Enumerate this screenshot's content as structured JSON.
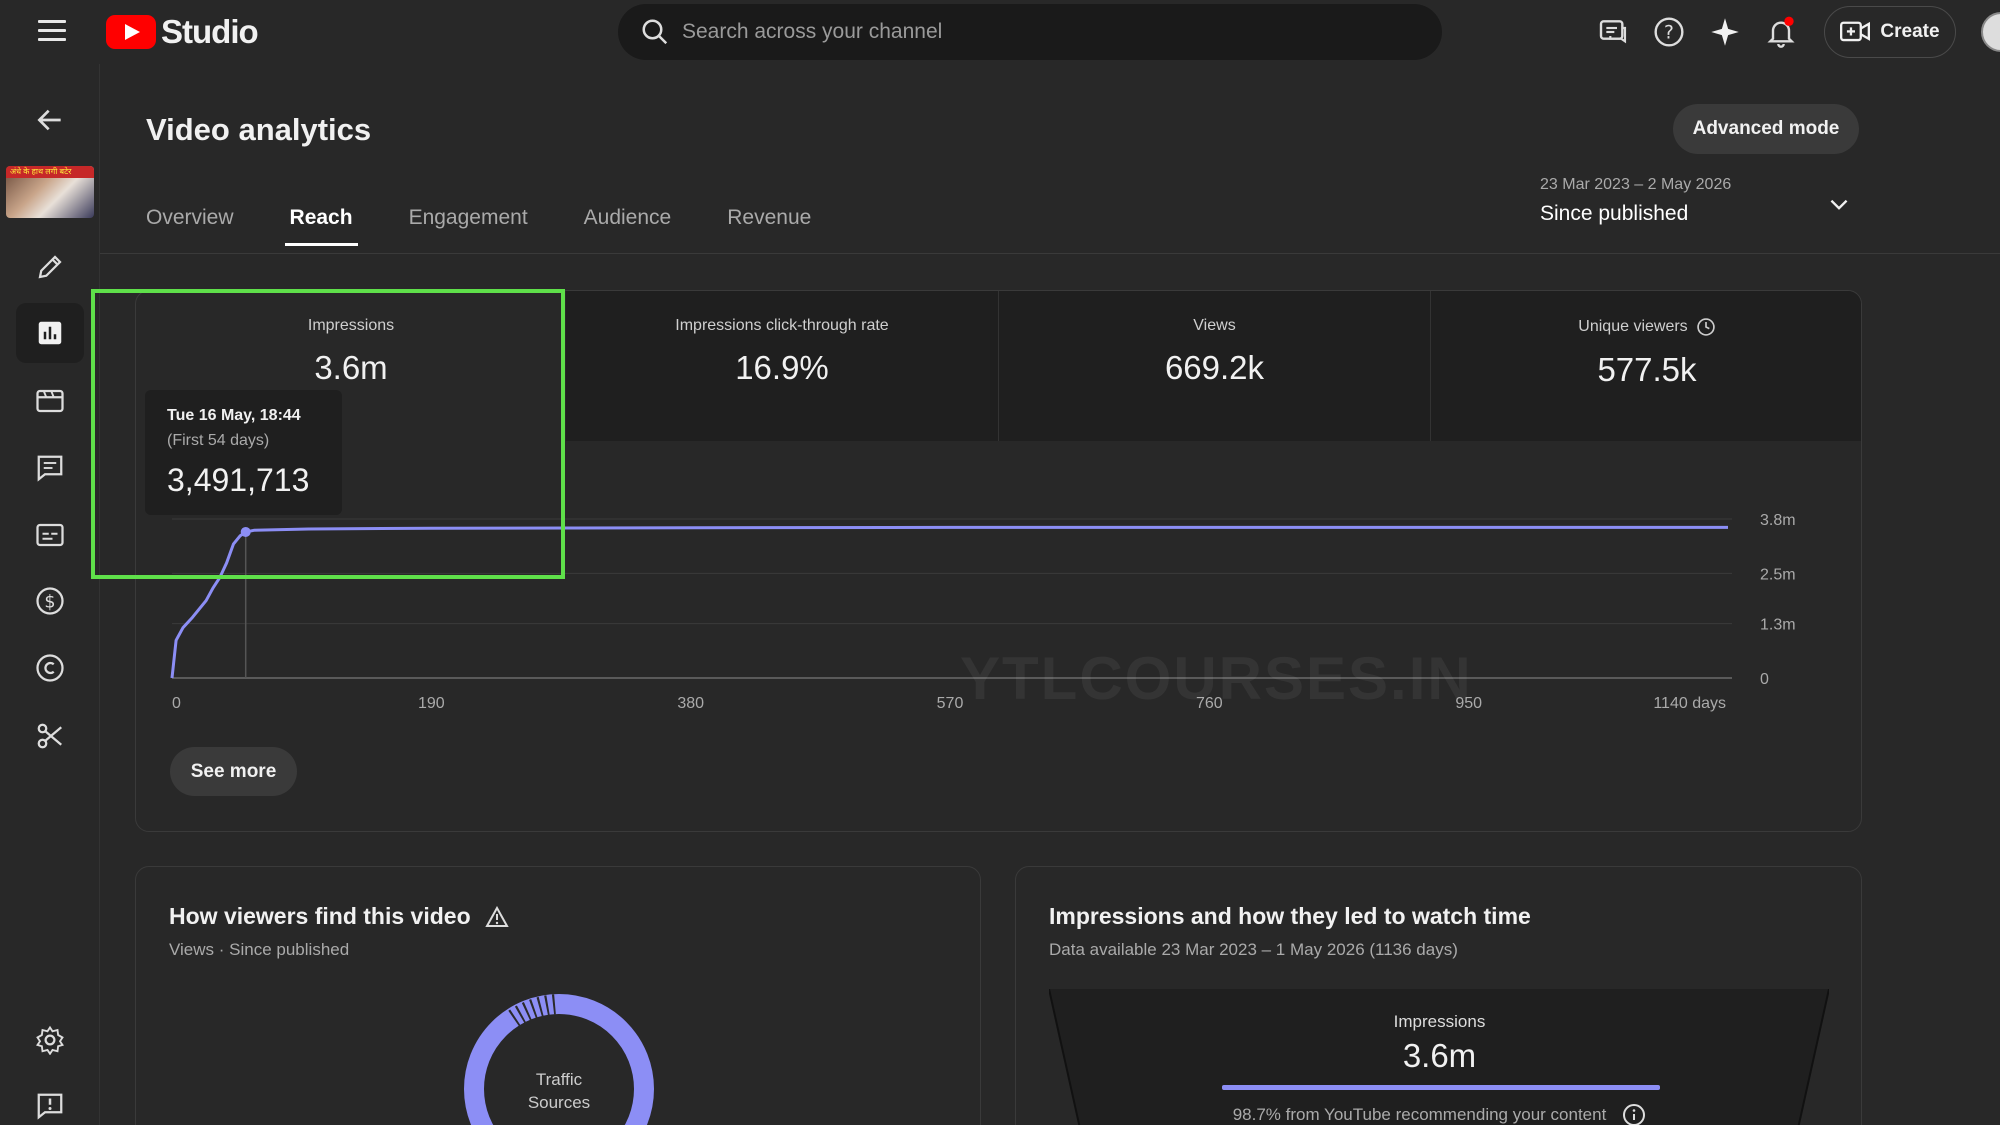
{
  "app": {
    "name": "Studio"
  },
  "search": {
    "placeholder": "Search across your channel"
  },
  "header": {
    "create_label": "Create"
  },
  "sidebar": {
    "thumbnail_text": "अंधे के हाथ लगी बटेर",
    "items": [
      "back-arrow",
      "details-pencil",
      "analytics",
      "editor",
      "comments",
      "subtitles",
      "monetization",
      "copyright",
      "clips"
    ],
    "bottom_items": [
      "settings",
      "feedback"
    ]
  },
  "page": {
    "title": "Video analytics",
    "advanced_mode": "Advanced mode",
    "tabs": [
      "Overview",
      "Reach",
      "Engagement",
      "Audience",
      "Revenue"
    ],
    "active_tab": "Reach",
    "date_range": "23 Mar 2023 – 2 May 2026",
    "date_preset": "Since published"
  },
  "metrics": [
    {
      "label": "Impressions",
      "value": "3.6m"
    },
    {
      "label": "Impressions click-through rate",
      "value": "16.9%"
    },
    {
      "label": "Views",
      "value": "669.2k"
    },
    {
      "label": "Unique viewers",
      "value": "577.5k"
    }
  ],
  "tooltip": {
    "date": "Tue 16 May, 18:44",
    "sub": "(First 54 days)",
    "value": "3,491,713"
  },
  "chart_data": {
    "type": "line",
    "series": [
      {
        "x": [
          0,
          3,
          8,
          15,
          25,
          30,
          35,
          40,
          45,
          50,
          54,
          60,
          100,
          190,
          380,
          570,
          760,
          950,
          1140
        ],
        "y": [
          0,
          0.9,
          1.2,
          1.45,
          1.85,
          2.15,
          2.4,
          2.75,
          3.2,
          3.4,
          3.49,
          3.53,
          3.56,
          3.58,
          3.59,
          3.6,
          3.6,
          3.6,
          3.6
        ]
      }
    ],
    "x_ticks": [
      "0",
      "190",
      "380",
      "570",
      "760",
      "950",
      "1140 days"
    ],
    "y_ticks": [
      "0",
      "1.3m",
      "2.5m",
      "3.8m"
    ],
    "xlim": [
      0,
      1140
    ],
    "ylim": [
      0,
      3.8
    ],
    "grid": true,
    "line_color": "#8c8ef5",
    "highlight_x": 54
  },
  "see_more": "See more",
  "watermark": "YTLCOURSES.IN",
  "find_card": {
    "title": "How viewers find this video",
    "subtitle": "Views · Since published",
    "donut_label_1": "Traffic",
    "donut_label_2": "Sources"
  },
  "impressions_card": {
    "title": "Impressions and how they led to watch time",
    "subtitle": "Data available 23 Mar 2023 – 1 May 2026 (1136 days)",
    "label": "Impressions",
    "value": "3.6m",
    "note": "98.7% from YouTube recommending your content"
  },
  "colors": {
    "accent": "#8c8ef5",
    "highlight": "#5fe04a",
    "brand": "#ff0000"
  }
}
